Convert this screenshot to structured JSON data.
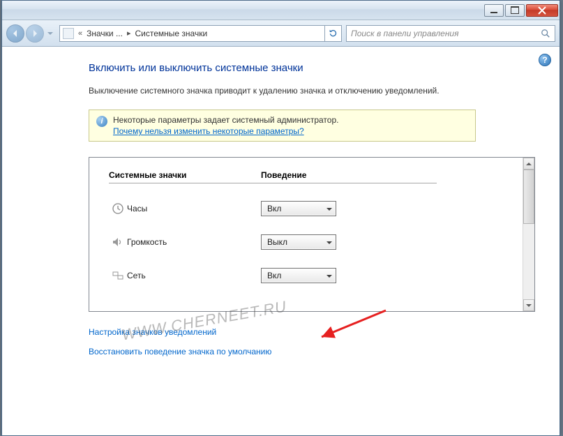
{
  "titlebar": {},
  "breadcrumb": {
    "chev_left": "«",
    "item1": "Значки ...",
    "sep": "▸",
    "item2": "Системные значки"
  },
  "search": {
    "placeholder": "Поиск в панели управления"
  },
  "page": {
    "title": "Включить или выключить системные значки",
    "description": "Выключение системного значка приводит к удалению значка и отключению уведомлений."
  },
  "notice": {
    "text": "Некоторые параметры задает системный администратор.",
    "link": "Почему нельзя изменить некоторые параметры?"
  },
  "table": {
    "header_icons": "Системные значки",
    "header_behavior": "Поведение",
    "rows": [
      {
        "name": "Часы",
        "value": "Вкл"
      },
      {
        "name": "Громкость",
        "value": "Выкл"
      },
      {
        "name": "Сеть",
        "value": "Вкл"
      }
    ]
  },
  "links": {
    "customize": "Настройка значков уведомлений",
    "restore": "Восстановить поведение значка по умолчанию"
  },
  "watermark": "WWW.CHERNEET.RU"
}
